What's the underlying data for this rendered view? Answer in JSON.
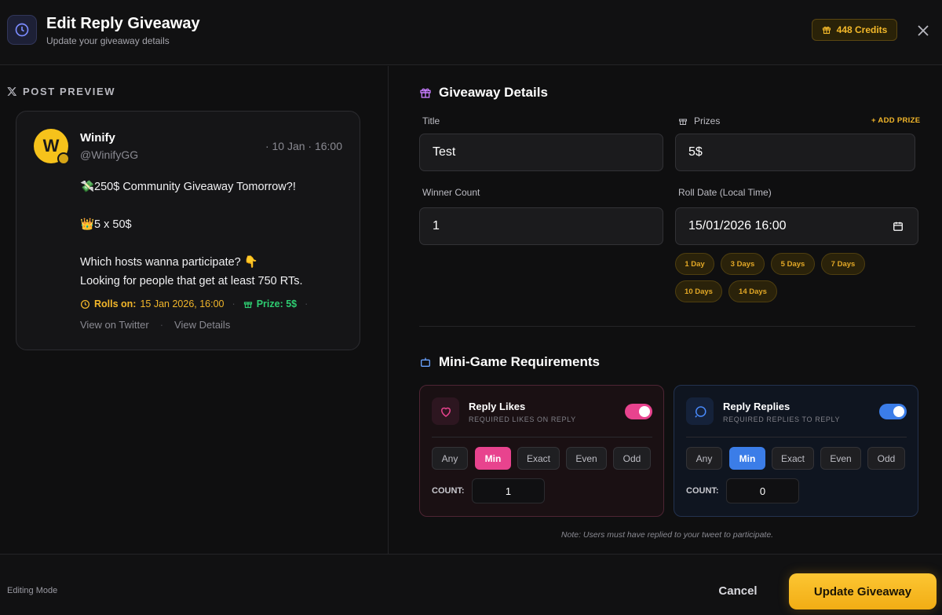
{
  "header": {
    "title": "Edit Reply Giveaway",
    "subtitle": "Update your giveaway details",
    "credits": "448 Credits",
    "icon": "clock-icon",
    "close_icon": "close-icon"
  },
  "post_preview": {
    "label": "POST PREVIEW",
    "author_name": "Winify",
    "author_handle": "@WinifyGG",
    "avatar_letter": "W",
    "date": "· 10 Jan · 16:00",
    "body_lines": [
      "💸250$ Community Giveaway Tomorrow?!",
      "",
      "👑5 x 50$",
      "",
      "Which hosts wanna participate? 👇",
      "Looking for people that get at least 750 RTs."
    ],
    "rolls_label": "Rolls on:",
    "rolls_value": "15 Jan 2026, 16:00",
    "prize_label": "Prize: 5$",
    "separator": "·",
    "view_on_twitter": "View on Twitter",
    "view_details": "View Details"
  },
  "giveaway_details": {
    "section_title": "Giveaway Details",
    "title_label": "Title",
    "title_value": "Test",
    "prizes_label": "Prizes",
    "add_prize": "+ ADD PRIZE",
    "prize_value": "5$",
    "winner_count_label": "Winner Count",
    "winner_count_value": "1",
    "roll_date_label": "Roll Date (Local Time)",
    "roll_date_value": "15/01/2026 16:00",
    "quick_chips": [
      "1 Day",
      "3 Days",
      "5 Days",
      "7 Days",
      "10 Days",
      "14 Days"
    ]
  },
  "mini_game": {
    "section_title": "Mini-Game Requirements",
    "cards": [
      {
        "title": "Reply Likes",
        "subtitle": "REQUIRED LIKES ON REPLY",
        "enabled": true,
        "modes": [
          "Any",
          "Min",
          "Exact",
          "Even",
          "Odd"
        ],
        "active_mode": "Min",
        "count_label": "COUNT:",
        "count_value": "1",
        "accent": "#e8438e"
      },
      {
        "title": "Reply Replies",
        "subtitle": "REQUIRED REPLIES TO REPLY",
        "enabled": true,
        "modes": [
          "Any",
          "Min",
          "Exact",
          "Even",
          "Odd"
        ],
        "active_mode": "Min",
        "count_label": "COUNT:",
        "count_value": "0",
        "accent": "#3b7de8"
      }
    ],
    "note": "Note: Users must have replied to your tweet to participate."
  },
  "footer": {
    "mode": "Editing Mode",
    "cancel": "Cancel",
    "update": "Update Giveaway"
  },
  "colors": {
    "accent_gold": "#f2b62a",
    "prize_green": "#2ecc71",
    "pink": "#e8438e",
    "blue": "#3b7de8"
  }
}
